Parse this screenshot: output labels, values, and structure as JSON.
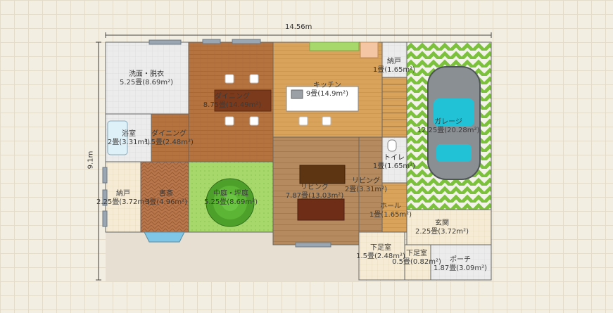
{
  "dimensions": {
    "width_label": "14.56m",
    "height_label": "9.1m"
  },
  "rooms": {
    "wash": {
      "name": "洗面・脱衣",
      "size": "5.25畳(8.69m²)"
    },
    "dining_big": {
      "name": "ダイニング",
      "size": "8.75畳(14.49m²)"
    },
    "kitchen": {
      "name": "キッチン",
      "size": "9畳(14.9m²)"
    },
    "storage_top": {
      "name": "納戸",
      "size": "1畳(1.65m²)"
    },
    "garage": {
      "name": "ガレージ",
      "size": "12.25畳(20.28m²)"
    },
    "bath": {
      "name": "浴室",
      "size": "2畳(3.31m²)"
    },
    "dining_small": {
      "name": "ダイニング",
      "size": "1.5畳(2.48m²)"
    },
    "toilet": {
      "name": "トイレ",
      "size": "1畳(1.65m²)"
    },
    "storage_left": {
      "name": "納戸",
      "size": "2.25畳(3.72m²)"
    },
    "study": {
      "name": "書斎",
      "size": "3畳(4.96m²)"
    },
    "courtyard": {
      "name": "中庭・坪庭",
      "size": "5.25畳(8.69m²)"
    },
    "living_big": {
      "name": "リビング",
      "size": "7.87畳(13.03m²)"
    },
    "living_small": {
      "name": "リビング",
      "size": "2畳(3.31m²)"
    },
    "hall": {
      "name": "ホール",
      "size": "1畳(1.65m²)"
    },
    "entrance": {
      "name": "玄関",
      "size": "2.25畳(3.72m²)"
    },
    "shoe_room_a": {
      "name": "下足室",
      "size": "1.5畳(2.48m²)"
    },
    "shoe_room_b": {
      "name": "下足室",
      "size": "0.5畳(0.82m²)"
    },
    "porch": {
      "name": "ポーチ",
      "size": "1.87畳(3.09m²)"
    }
  },
  "colors": {
    "wood_dark": "#b5733f",
    "wood_light": "#d9a35c",
    "wood_living": "#b58a5e",
    "tile": "#ebebeb",
    "lawn": "#8fce4a",
    "garage_zig": "#7cc13c",
    "pool": "#7fc6e6"
  },
  "icons": [
    "tree-icon",
    "car-icon",
    "sofa-icon",
    "table-icon",
    "sink-icon",
    "toilet-icon",
    "bathtub-icon",
    "stairs-icon"
  ]
}
